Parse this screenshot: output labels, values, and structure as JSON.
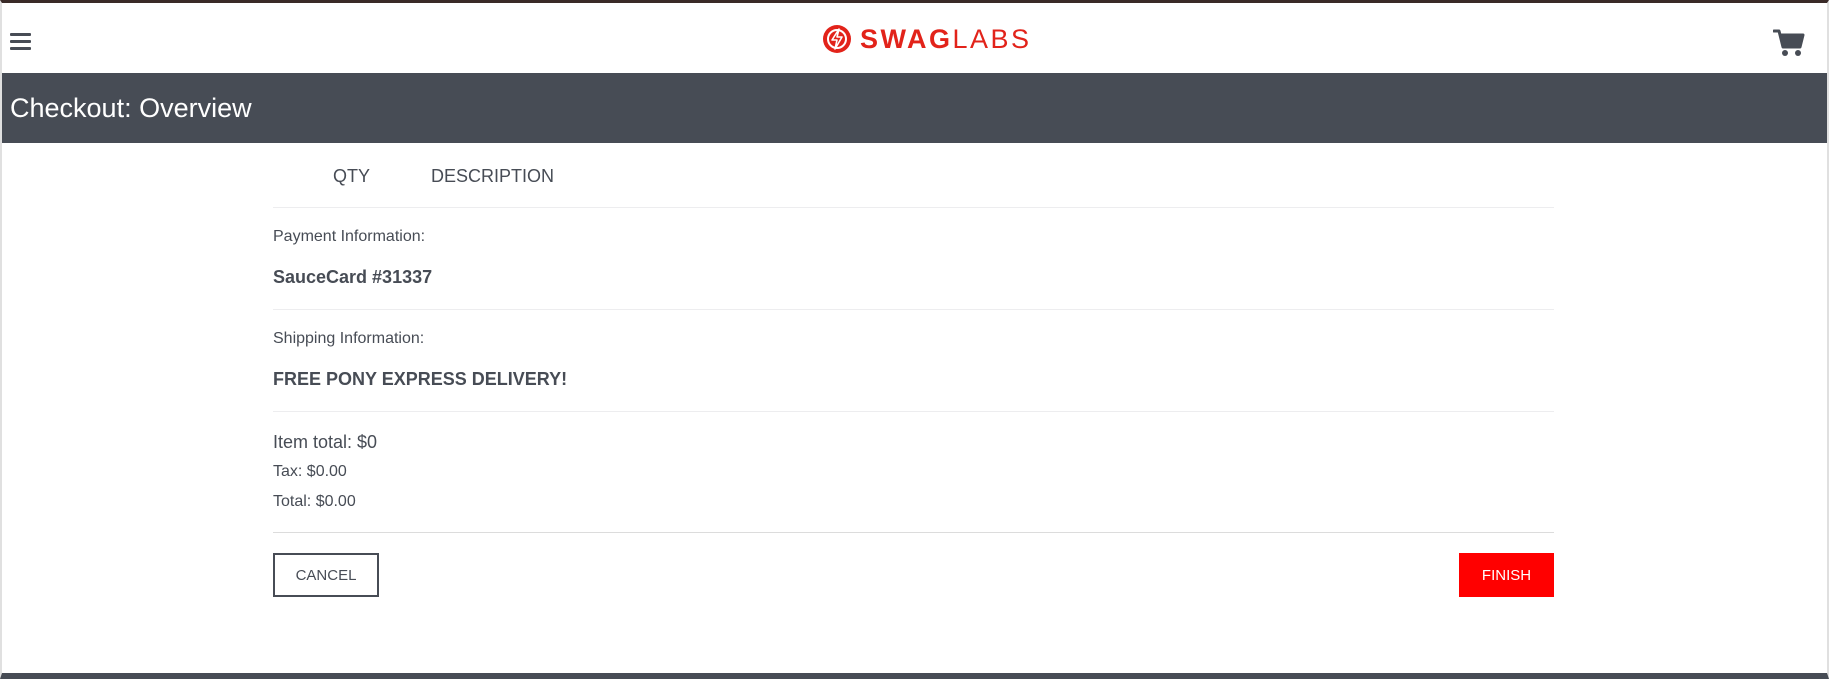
{
  "header": {
    "logo": {
      "bold_text": "SWAG",
      "light_text": "LABS",
      "icon": "swaglabs-logo-icon",
      "color": "#e2231a"
    },
    "menu_icon": "hamburger-menu-icon",
    "cart_icon": "shopping-cart-icon"
  },
  "title_bar": {
    "title": "Checkout: Overview",
    "background": "#474c55"
  },
  "cart_list": {
    "qty_label": "QTY",
    "description_label": "DESCRIPTION"
  },
  "summary": {
    "payment_label": "Payment Information:",
    "payment_value": "SauceCard #31337",
    "shipping_label": "Shipping Information:",
    "shipping_value": "FREE PONY EXPRESS DELIVERY!",
    "item_total": "Item total: $0",
    "tax": "Tax: $0.00",
    "total": "Total: $0.00"
  },
  "actions": {
    "cancel_label": "CANCEL",
    "finish_label": "FINISH",
    "finish_color": "#ff0000"
  }
}
